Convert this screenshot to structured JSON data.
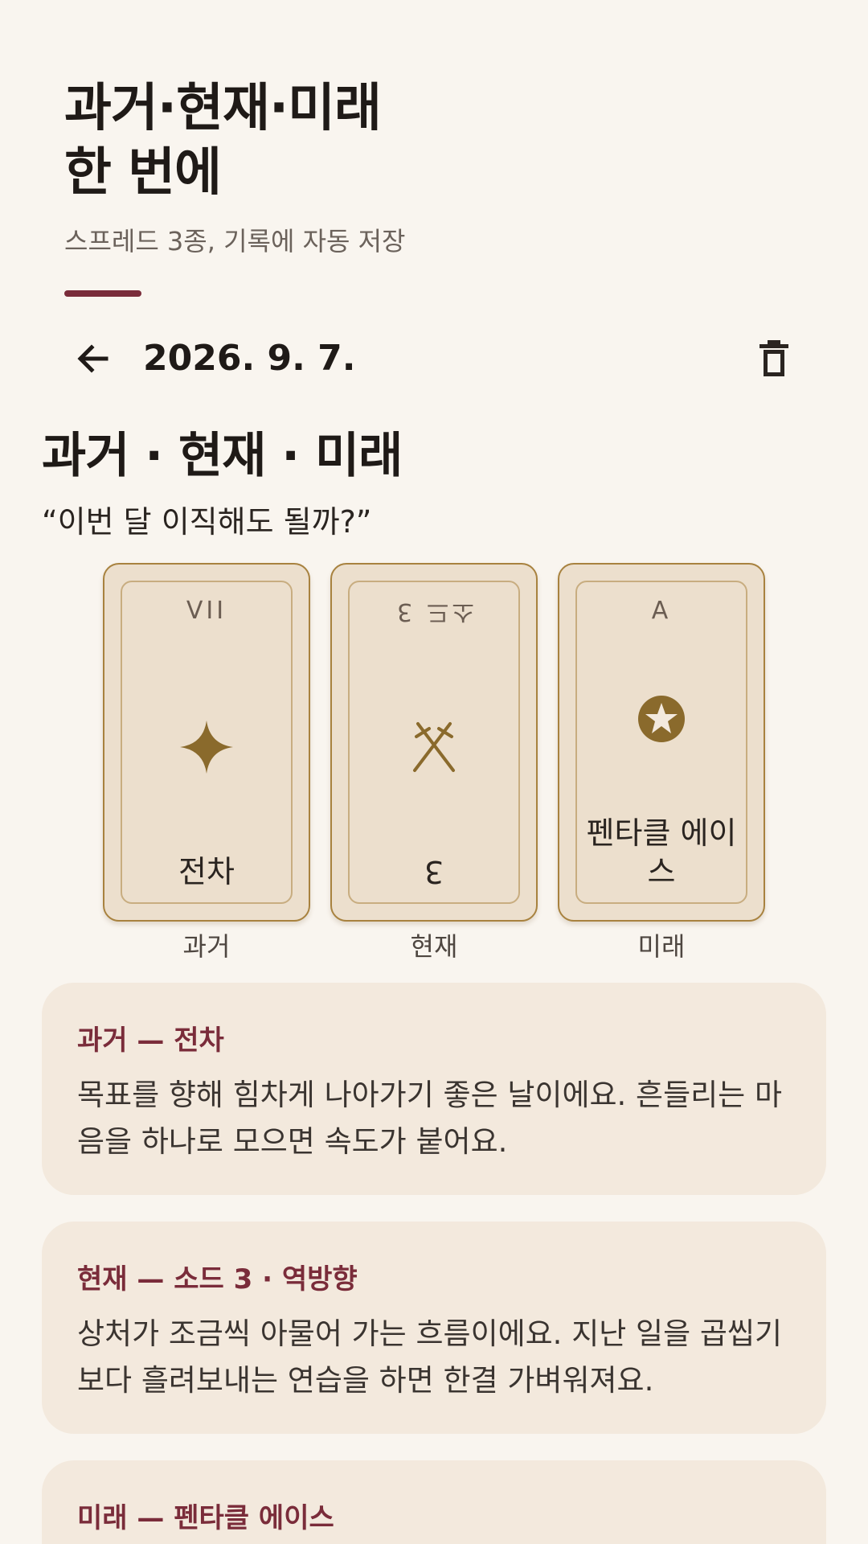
{
  "hero": {
    "title": "과거·현재·미래\n한 번에",
    "subtitle": "스프레드 3종, 기록에 자동 저장"
  },
  "header": {
    "date": "2026. 9. 7.",
    "back_icon": "arrow-left-icon",
    "delete_icon": "trash-icon"
  },
  "spread": {
    "title": "과거 · 현재 · 미래",
    "question": "“이번 달 이직해도 될까?”"
  },
  "cards": [
    {
      "number": "VII",
      "name": "전차",
      "position": "과거",
      "icon": "four-point-star-icon",
      "reversed": false
    },
    {
      "number": "3",
      "name": "소드 3",
      "position": "현재",
      "icon": "crossed-swords-icon",
      "reversed": true
    },
    {
      "number": "A",
      "name": "펜타클 에이스",
      "position": "미래",
      "icon": "pentacle-icon",
      "reversed": false
    }
  ],
  "readings": [
    {
      "title": "과거 — 전차",
      "body": "목표를 향해 힘차게 나아가기 좋은 날이에요. 흔들리는 마음을 하나로 모으면 속도가 붙어요."
    },
    {
      "title": "현재 — 소드 3 · 역방향",
      "body": "상처가 조금씩 아물어 가는 흐름이에요. 지난 일을 곱씹기보다 흘려보내는 연습을 하면 한결 가벼워져요."
    },
    {
      "title": "미래 — 펜타클 에이스",
      "body": ""
    }
  ],
  "colors": {
    "background": "#f9f5ef",
    "accent": "#7a2c3a",
    "card_gold": "#8a6a2c",
    "card_face": "#ecdfcd",
    "reading_bg": "#f3e9dd"
  }
}
